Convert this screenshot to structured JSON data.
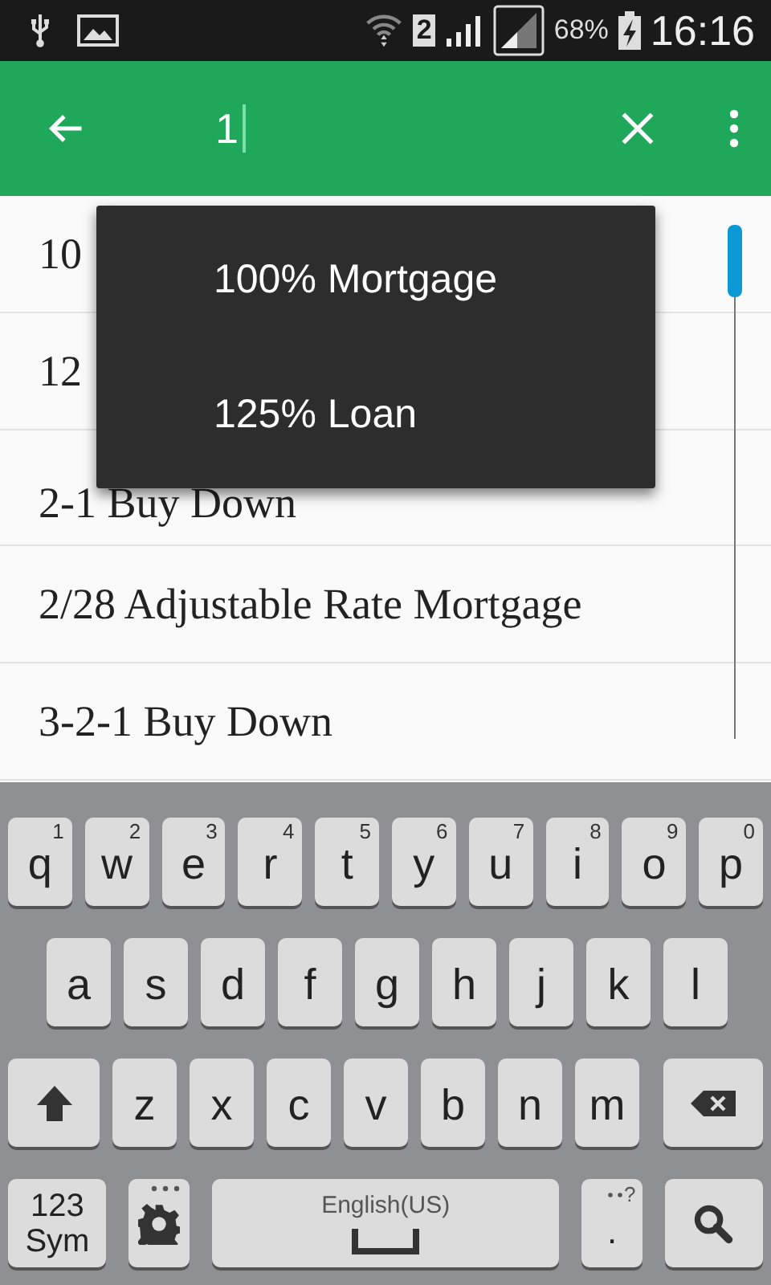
{
  "status_bar": {
    "sim": "2",
    "battery": "68%",
    "time": "16:16"
  },
  "app_bar": {
    "search": {
      "value": "1"
    }
  },
  "list": [
    {
      "text": "10"
    },
    {
      "text": "12"
    },
    {
      "text": "2-1 Buy Down"
    },
    {
      "text": "2/28 Adjustable Rate Mortgage"
    },
    {
      "text": "3-2-1 Buy Down"
    }
  ],
  "suggestions": [
    {
      "text": "100% Mortgage"
    },
    {
      "text": "125% Loan"
    }
  ],
  "keyboard": [
    [
      {
        "kind": "letter",
        "label": "q",
        "hint": "1"
      },
      {
        "kind": "letter",
        "label": "w",
        "hint": "2"
      },
      {
        "kind": "letter",
        "label": "e",
        "hint": "3"
      },
      {
        "kind": "letter",
        "label": "r",
        "hint": "4"
      },
      {
        "kind": "letter",
        "label": "t",
        "hint": "5"
      },
      {
        "kind": "letter",
        "label": "y",
        "hint": "6"
      },
      {
        "kind": "letter",
        "label": "u",
        "hint": "7"
      },
      {
        "kind": "letter",
        "label": "i",
        "hint": "8"
      },
      {
        "kind": "letter",
        "label": "o",
        "hint": "9"
      },
      {
        "kind": "letter",
        "label": "p",
        "hint": "0"
      }
    ],
    [
      {
        "kind": "letter",
        "label": "a"
      },
      {
        "kind": "letter",
        "label": "s"
      },
      {
        "kind": "letter",
        "label": "d"
      },
      {
        "kind": "letter",
        "label": "f"
      },
      {
        "kind": "letter",
        "label": "g"
      },
      {
        "kind": "letter",
        "label": "h"
      },
      {
        "kind": "letter",
        "label": "j"
      },
      {
        "kind": "letter",
        "label": "k"
      },
      {
        "kind": "letter",
        "label": "l"
      }
    ],
    [
      {
        "kind": "shift"
      },
      {
        "kind": "letter",
        "label": "z"
      },
      {
        "kind": "letter",
        "label": "x"
      },
      {
        "kind": "letter",
        "label": "c"
      },
      {
        "kind": "letter",
        "label": "v"
      },
      {
        "kind": "letter",
        "label": "b"
      },
      {
        "kind": "letter",
        "label": "n"
      },
      {
        "kind": "letter",
        "label": "m"
      },
      {
        "kind": "backspace"
      }
    ],
    [
      {
        "kind": "mode",
        "label": "123 Sym"
      },
      {
        "kind": "settings"
      },
      {
        "kind": "space",
        "label": "English(US)"
      },
      {
        "kind": "period",
        "label": ".",
        "hint": "?"
      },
      {
        "kind": "search"
      }
    ]
  ]
}
